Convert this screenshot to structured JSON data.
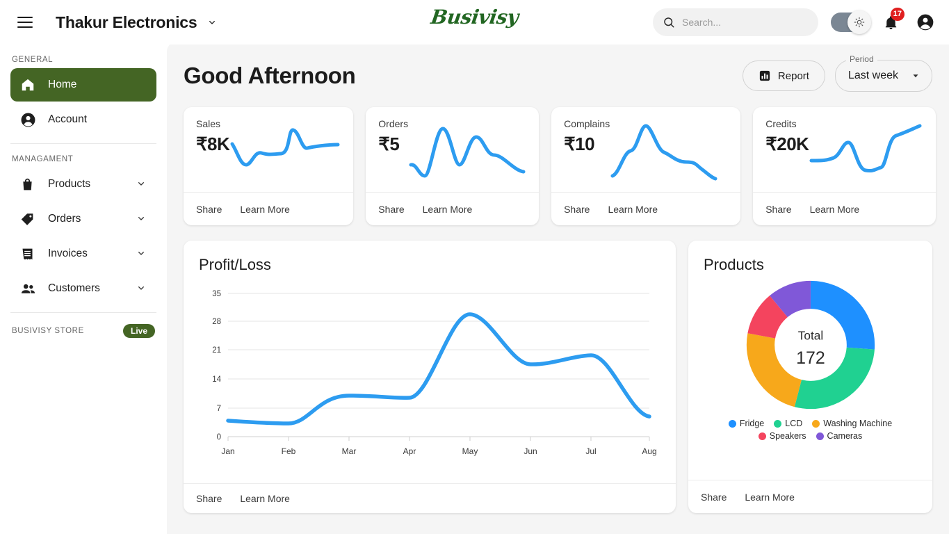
{
  "topbar": {
    "menu_icon": "hamburger-icon",
    "company": "Thakur Electronics",
    "company_caret": "∨",
    "logo": "Busivisy",
    "search_placeholder": "Search...",
    "search_value": "",
    "search_icon": "search-icon",
    "theme_icon": "sun-icon",
    "bell_icon": "bell-icon",
    "notification_count": "17",
    "account_icon": "account-circle-icon"
  },
  "sidebar": {
    "general_label": "GENERAL",
    "general_items": [
      {
        "label": "Home",
        "icon": "home-icon",
        "active": true
      },
      {
        "label": "Account",
        "icon": "account-circle-icon",
        "active": false
      }
    ],
    "management_label": "MANAGAMENT",
    "management_items": [
      {
        "label": "Products",
        "icon": "shopping-bag-icon",
        "chevron": "∨"
      },
      {
        "label": "Orders",
        "icon": "tag-icon",
        "chevron": "∨"
      },
      {
        "label": "Invoices",
        "icon": "receipt-icon",
        "chevron": "∨"
      },
      {
        "label": "Customers",
        "icon": "people-icon",
        "chevron": "∨"
      }
    ],
    "store_name": "BUSIVISY STORE",
    "store_status": "Live"
  },
  "header": {
    "greeting": "Good Afternoon",
    "report_label": "Report",
    "report_icon": "bar-chart-icon",
    "period_label": "Period",
    "period_value": "Last week",
    "period_caret": "▾"
  },
  "stats": [
    {
      "title": "Sales",
      "value": "₹8K",
      "share": "Share",
      "learn": "Learn More"
    },
    {
      "title": "Orders",
      "value": "₹5",
      "share": "Share",
      "learn": "Learn More"
    },
    {
      "title": "Complains",
      "value": "₹10",
      "share": "Share",
      "learn": "Learn More"
    },
    {
      "title": "Credits",
      "value": "₹20K",
      "share": "Share",
      "learn": "Learn More"
    }
  ],
  "profit_card": {
    "title": "Profit/Loss",
    "share": "Share",
    "learn": "Learn More"
  },
  "products_card": {
    "title": "Products",
    "center_label": "Total",
    "center_value": "172",
    "share": "Share",
    "learn": "Learn More"
  },
  "colors": {
    "accent_green": "#446524",
    "line_blue": "#2d9cf0",
    "badge_red": "#e02020",
    "fridge": "#1e90ff",
    "lcd": "#20d191",
    "washing_machine": "#f7a81b",
    "speakers": "#f4445e",
    "cameras": "#8058d8"
  },
  "chart_data": [
    {
      "type": "line",
      "title": "Profit/Loss",
      "categories": [
        "Jan",
        "Feb",
        "Mar",
        "Apr",
        "May",
        "Jun",
        "Jul",
        "Aug"
      ],
      "values": [
        4,
        3.3,
        10,
        9.3,
        29,
        18,
        22,
        8
      ],
      "xlabel": "",
      "ylabel": "",
      "yticks": [
        0,
        7,
        14,
        21,
        28,
        35
      ],
      "ylim": [
        0,
        35
      ],
      "grid": true,
      "legend": "none",
      "series_color": "#2d9cf0"
    },
    {
      "type": "pie",
      "title": "Products",
      "subtype": "donut",
      "total_label": "Total",
      "total": 172,
      "labels": [
        "Fridge",
        "LCD",
        "Washing Machine",
        "Speakers",
        "Cameras"
      ],
      "values": [
        45,
        48,
        41,
        19,
        19
      ],
      "colors": [
        "#1e90ff",
        "#20d191",
        "#f7a81b",
        "#f4445e",
        "#8058d8"
      ],
      "legend": "bottom"
    },
    {
      "type": "line",
      "title": "Sales sparkline",
      "series_color": "#2d9cf0",
      "values": [
        22,
        12,
        5,
        11,
        12,
        11,
        30,
        22,
        23,
        23
      ]
    },
    {
      "type": "line",
      "title": "Orders sparkline",
      "series_color": "#2d9cf0",
      "values": [
        8,
        4,
        32,
        14,
        28,
        22,
        19,
        10
      ]
    },
    {
      "type": "line",
      "title": "Complains sparkline",
      "series_color": "#2d9cf0",
      "values": [
        3,
        16,
        34,
        17,
        13,
        13,
        6
      ]
    },
    {
      "type": "line",
      "title": "Credits sparkline",
      "series_color": "#2d9cf0",
      "values": [
        14,
        14,
        22,
        9,
        9,
        27,
        31
      ]
    }
  ]
}
